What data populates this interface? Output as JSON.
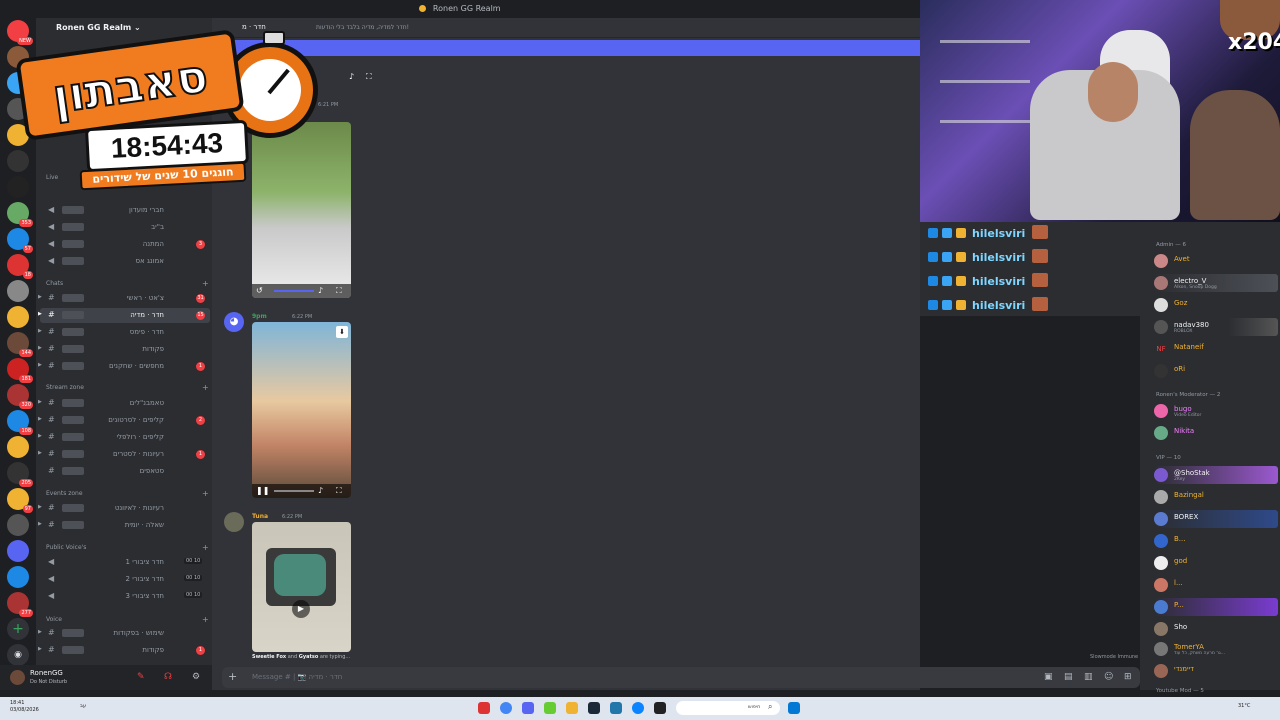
{
  "window": {
    "title": "Ronen GG Realm"
  },
  "rail": {
    "badges": [
      "NEW",
      "353",
      "57",
      "18",
      "144",
      "181",
      "320",
      "108",
      "205",
      "97",
      "277"
    ]
  },
  "server": {
    "name": "Ronen GG Realm"
  },
  "categories": {
    "live": "Live",
    "chats": "Chats",
    "stream_zone": "Stream zone",
    "events_zone": "Events zone",
    "public_voices": "Public Voice's",
    "voice": "Voice"
  },
  "channels": {
    "live": [
      {
        "name": "חברי מועדון"
      },
      {
        "name": "ב\"יב"
      },
      {
        "name": "המתנה",
        "badge": "3"
      },
      {
        "name": "אמונג אס"
      }
    ],
    "chats": [
      {
        "name": "צ'אט · ראשי",
        "badge": "31"
      },
      {
        "name": "חדר · מדיה",
        "badge": "15"
      },
      {
        "name": "חדר · פימס"
      },
      {
        "name": "פקודות"
      },
      {
        "name": "מחפשים · שחקנים",
        "badge": "1"
      }
    ],
    "stream": [
      {
        "name": "טאמבנ\"לים"
      },
      {
        "name": "קליפים · לסרטונים",
        "badge": "2"
      },
      {
        "name": "קליפים · רולפלי"
      },
      {
        "name": "רעיונות · לסטרים",
        "badge": "1"
      },
      {
        "name": "סטאפים"
      }
    ],
    "events": [
      {
        "name": "רעיונות · לאיוונט"
      },
      {
        "name": "שאלה · יומית"
      }
    ],
    "public": [
      {
        "name": "חדר ציבורי 1",
        "count": "00 10"
      },
      {
        "name": "חדר ציבורי 2",
        "count": "00 10"
      },
      {
        "name": "חדר ציבורי 3",
        "count": "00 10"
      }
    ],
    "voice": [
      {
        "name": "שימוש · בפקודות"
      },
      {
        "name": "פקודות",
        "badge": "1"
      }
    ]
  },
  "user": {
    "name": "RonenGG",
    "status": "Do Not Disturb"
  },
  "topbar": {
    "channel": "חדר · מ",
    "topic": "חדר למדיה, מדיה בלבד בלי הודעות!"
  },
  "messages": [
    {
      "author": "",
      "time": "6:21 PM"
    },
    {
      "author": "9pm",
      "time": "6:22 PM",
      "author_color": "#3ba55d"
    },
    {
      "author": "Tuna",
      "time": "6:22 PM",
      "author_color": "#f0b232"
    }
  ],
  "typing": {
    "names": "Sweetie Fox",
    "and": "and",
    "names2": "Gyatso",
    "suffix": "are typing..."
  },
  "slowmode": "Slowmode Immune",
  "composer": {
    "placeholder": "Message # | 📷 חדר · מדיה"
  },
  "stream_chat": [
    {
      "name": "hilelsviri"
    },
    {
      "name": "hilelsviri"
    },
    {
      "name": "hilelsviri"
    },
    {
      "name": "hilelsviri"
    }
  ],
  "cam": {
    "multiplier": "x204"
  },
  "members": {
    "admin_header": "Admin — 6",
    "admins": [
      {
        "name": "Avet",
        "color": "#f0b232"
      },
      {
        "name": "electro_V",
        "sub": "Alkon, Snoop Dogg",
        "color": "#f2f3f5"
      },
      {
        "name": "Goz",
        "color": "#f0b232"
      },
      {
        "name": "nadav380",
        "sub": "ROBLOX",
        "color": "#f2f3f5"
      },
      {
        "name": "Nataneif",
        "color": "#f0b232"
      },
      {
        "name": "oRi",
        "color": "#f0b232"
      }
    ],
    "mod_header": "Ronen's Moderator — 2",
    "mods": [
      {
        "name": "bugo",
        "sub": "Video Editor",
        "color": "#f47fff"
      },
      {
        "name": "Nikita",
        "color": "#f47fff"
      }
    ],
    "vip_header": "VIP — 10",
    "vips": [
      {
        "name": "@ShoStak",
        "sub": "2Key",
        "color": "#f2f3f5"
      },
      {
        "name": "Bazingal",
        "color": "#f0b232"
      },
      {
        "name": "BOREX",
        "color": "#f2f3f5"
      },
      {
        "name": "B...",
        "color": "#f0b232"
      },
      {
        "name": "god",
        "color": "#f0b232"
      },
      {
        "name": "l...",
        "color": "#f0b232"
      },
      {
        "name": "P...",
        "color": "#f0b232"
      },
      {
        "name": "Sho",
        "color": "#f2f3f5"
      },
      {
        "name": "TomerYA",
        "sub": "גר מרעה משחק, כל עוד...",
        "color": "#f0b232"
      },
      {
        "name": "דיימנדי",
        "color": "#f0b232"
      }
    ],
    "youtube_header": "Youtube Mod — 5"
  },
  "subathon": {
    "title": "סאבתון",
    "timer": "18:54:43",
    "tagline": "חוגגים 10 שנים של שידורים"
  },
  "taskbar": {
    "time": "18:41",
    "date": "03/08/2026",
    "search": "חיפוש",
    "weather": "31°C",
    "lang": "עב"
  }
}
